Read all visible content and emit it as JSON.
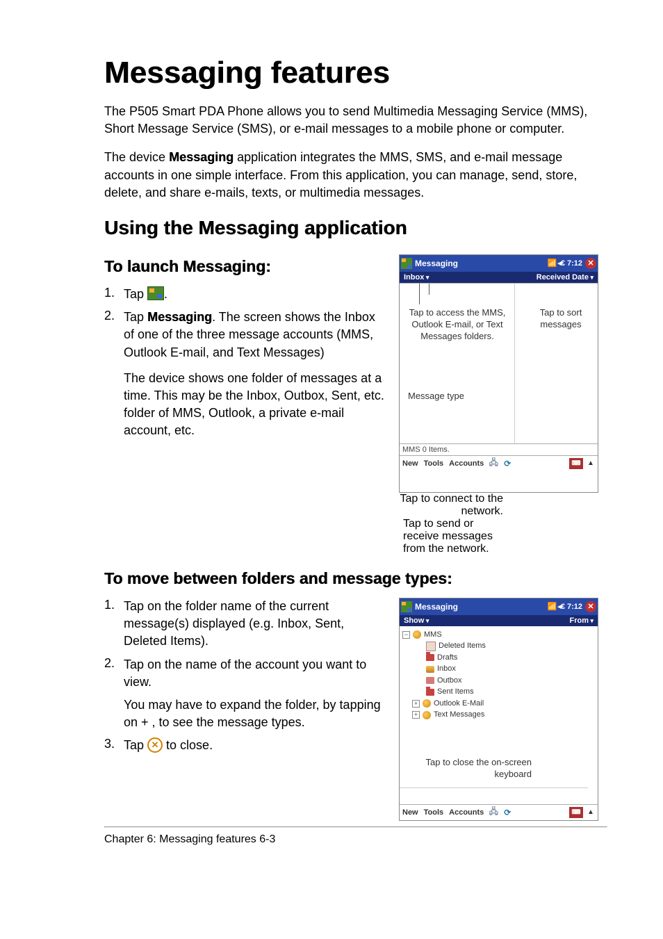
{
  "title": "Messaging features",
  "intro1": "The P505 Smart PDA Phone allows you to send Multimedia Messaging Service (MMS), Short Message Service (SMS), or e-mail messages to a mobile phone or computer.",
  "intro2_pre": "The device ",
  "intro2_bold": "Messaging",
  "intro2_post": " application integrates the MMS, SMS, and e-mail message accounts in one simple interface. From this application, you can manage, send, store, delete, and share e-mails, texts, or multimedia messages.",
  "section1": "Using the Messaging application",
  "sub1": "To launch Messaging:",
  "steps1": {
    "n1": "1.",
    "t1_pre": "Tap ",
    "t1_post": ".",
    "n2": "2.",
    "t2_pre": "Tap ",
    "t2_bold": "Messaging",
    "t2_post": ". The screen shows the Inbox of one of the three message accounts (MMS, Outlook E-mail, and Text Messages)"
  },
  "block1": "The device shows one folder of messages at a time. This may be the Inbox, Outbox, Sent, etc. folder of MMS, Outlook, a private e-mail account, etc.",
  "sub2": "To move between folders and message types:",
  "steps2": {
    "n1": "1.",
    "t1": "Tap on the folder name of the current message(s) displayed (e.g. Inbox, Sent, Deleted Items).",
    "n2": "2.",
    "t2": "Tap on the name of the account you want to view.",
    "t2b": "You may have to expand the folder, by tapping on + , to see the message types.",
    "n3": "3.",
    "t3_pre": "Tap ",
    "t3_post": " to close."
  },
  "dev1": {
    "title": "Messaging",
    "time": "7:12",
    "sub_left": "Inbox",
    "sub_right": "Received Date",
    "annot_access": "Tap to access the MMS, Outlook E-mail, or Text Messages folders.",
    "annot_sort": "Tap to sort messages",
    "annot_type": "Message type",
    "status": "MMS  0 Items.",
    "bottom": {
      "new": "New",
      "tools": "Tools",
      "accounts": "Accounts"
    },
    "under_left": "Tap to connect to the network.",
    "under_right": "Tap to send or receive messages from the network."
  },
  "dev2": {
    "title": "Messaging",
    "time": "7:12",
    "sub_left": "Show",
    "sub_right": "From",
    "tree": {
      "mms": "MMS",
      "deleted": "Deleted Items",
      "drafts": "Drafts",
      "inbox": "Inbox",
      "outbox": "Outbox",
      "sent": "Sent Items",
      "outlook": "Outlook E-Mail",
      "text": "Text Messages"
    },
    "annot_close": "Tap to close the on-screen keyboard",
    "bottom": {
      "new": "New",
      "tools": "Tools",
      "accounts": "Accounts"
    }
  },
  "footer": {
    "left": "Chapter 6: Messaging features",
    "right": "6-3"
  }
}
